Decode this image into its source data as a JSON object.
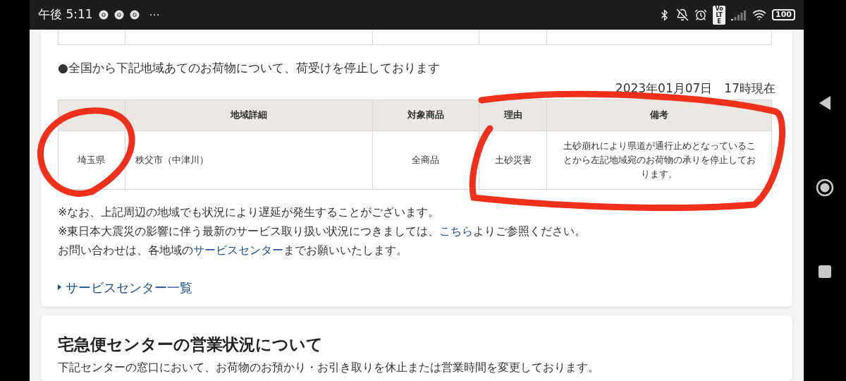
{
  "status_bar": {
    "time": "午後 5:11",
    "more": "⋯",
    "volte": "VoLTE",
    "battery": "100"
  },
  "notice": {
    "heading": "●全国から下記地域あてのお荷物について、荷受けを停止しております",
    "as_of": "2023年01月07日　17時現在"
  },
  "table": {
    "columns": [
      "地域詳細",
      "対象商品",
      "理由",
      "備考"
    ],
    "rows": [
      {
        "prefecture": "埼玉県",
        "area": "秩父市（中津川）",
        "items": "全商品",
        "reason": "土砂災害",
        "remarks": "土砂崩れにより県道が通行止めとなっていることから左記地域宛のお荷物の承りを停止しております。"
      }
    ]
  },
  "notes": [
    {
      "text": "※なお、上記周辺の地域でも状況により遅延が発生することがございます。"
    },
    {
      "before": "※東日本大震災の影響に伴う最新のサービス取り扱い状況につきましては、",
      "link": "こちら",
      "after": "よりご参照ください。"
    },
    {
      "before": "お問い合わせは、各地域の",
      "link": "サービスセンター",
      "after": "までお願いいたします。"
    }
  ],
  "service_link": "サービスセンター一覧",
  "section": {
    "title": "宅急便センターの営業状況について",
    "text": "下記センターの窓口において、お荷物のお預かり・お引き取りを休止または営業時間を変更しております。"
  }
}
